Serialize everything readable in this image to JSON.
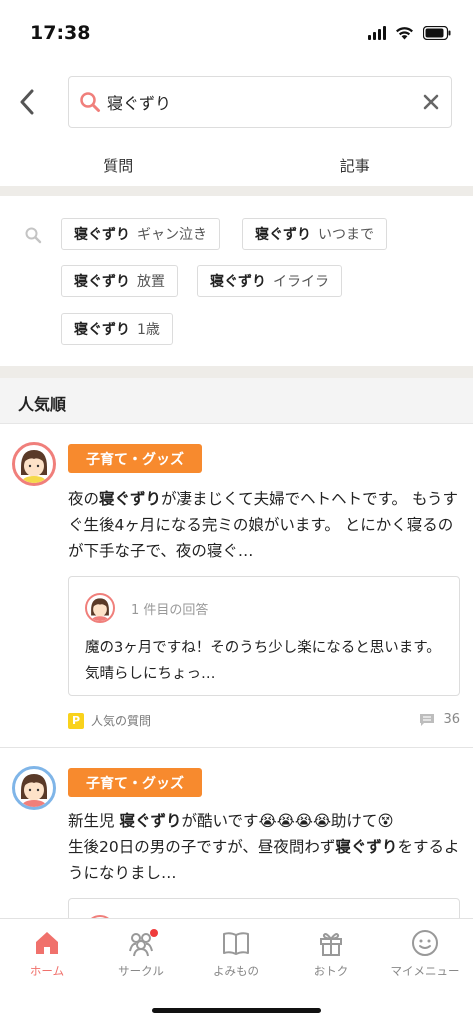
{
  "status_bar": {
    "time": "17:38"
  },
  "search": {
    "query": "寝ぐずり"
  },
  "tabs": [
    {
      "label": "質問",
      "active": true
    },
    {
      "label": "記事",
      "active": false
    }
  ],
  "suggestions": [
    {
      "keyword": "寝ぐずり",
      "extra": "ギャン泣き"
    },
    {
      "keyword": "寝ぐずり",
      "extra": "いつまで"
    },
    {
      "keyword": "寝ぐずり",
      "extra": "放置"
    },
    {
      "keyword": "寝ぐずり",
      "extra": "イライラ"
    },
    {
      "keyword": "寝ぐずり",
      "extra": "1歳"
    }
  ],
  "sort_header": "人気順",
  "questions": [
    {
      "category": "子育て・グッズ",
      "text_parts": [
        "夜の",
        "寝ぐずり",
        "が凄まじくて夫婦でヘトヘトです。 もうすぐ生後4ヶ月になる完ミの娘がいます。 とにかく寝るのが下手な子で、夜の寝ぐ…"
      ],
      "answer_label": "1 件目の回答",
      "answer_text": "魔の3ヶ月ですね！そのうち少し楽になると思います。 気晴らしにちょっ…",
      "popular_label": "人気の質問",
      "comment_count": "36"
    },
    {
      "category": "子育て・グッズ",
      "text_parts": [
        "新生児 ",
        "寝ぐずり",
        "が酷いです😭😭😭😭助けて😵",
        "生後20日の男の子ですが、昼夜問わず",
        "寝ぐずり",
        "をするようになりまし…"
      ]
    }
  ],
  "bottom_nav": [
    {
      "label": "ホーム",
      "active": true
    },
    {
      "label": "サークル",
      "active": false
    },
    {
      "label": "よみもの",
      "active": false
    },
    {
      "label": "おトク",
      "active": false
    },
    {
      "label": "マイメニュー",
      "active": false
    }
  ],
  "colors": {
    "accent_pink": "#f07f7b",
    "tag_orange": "#f78a2e",
    "popular_yellow": "#f9d21c"
  }
}
